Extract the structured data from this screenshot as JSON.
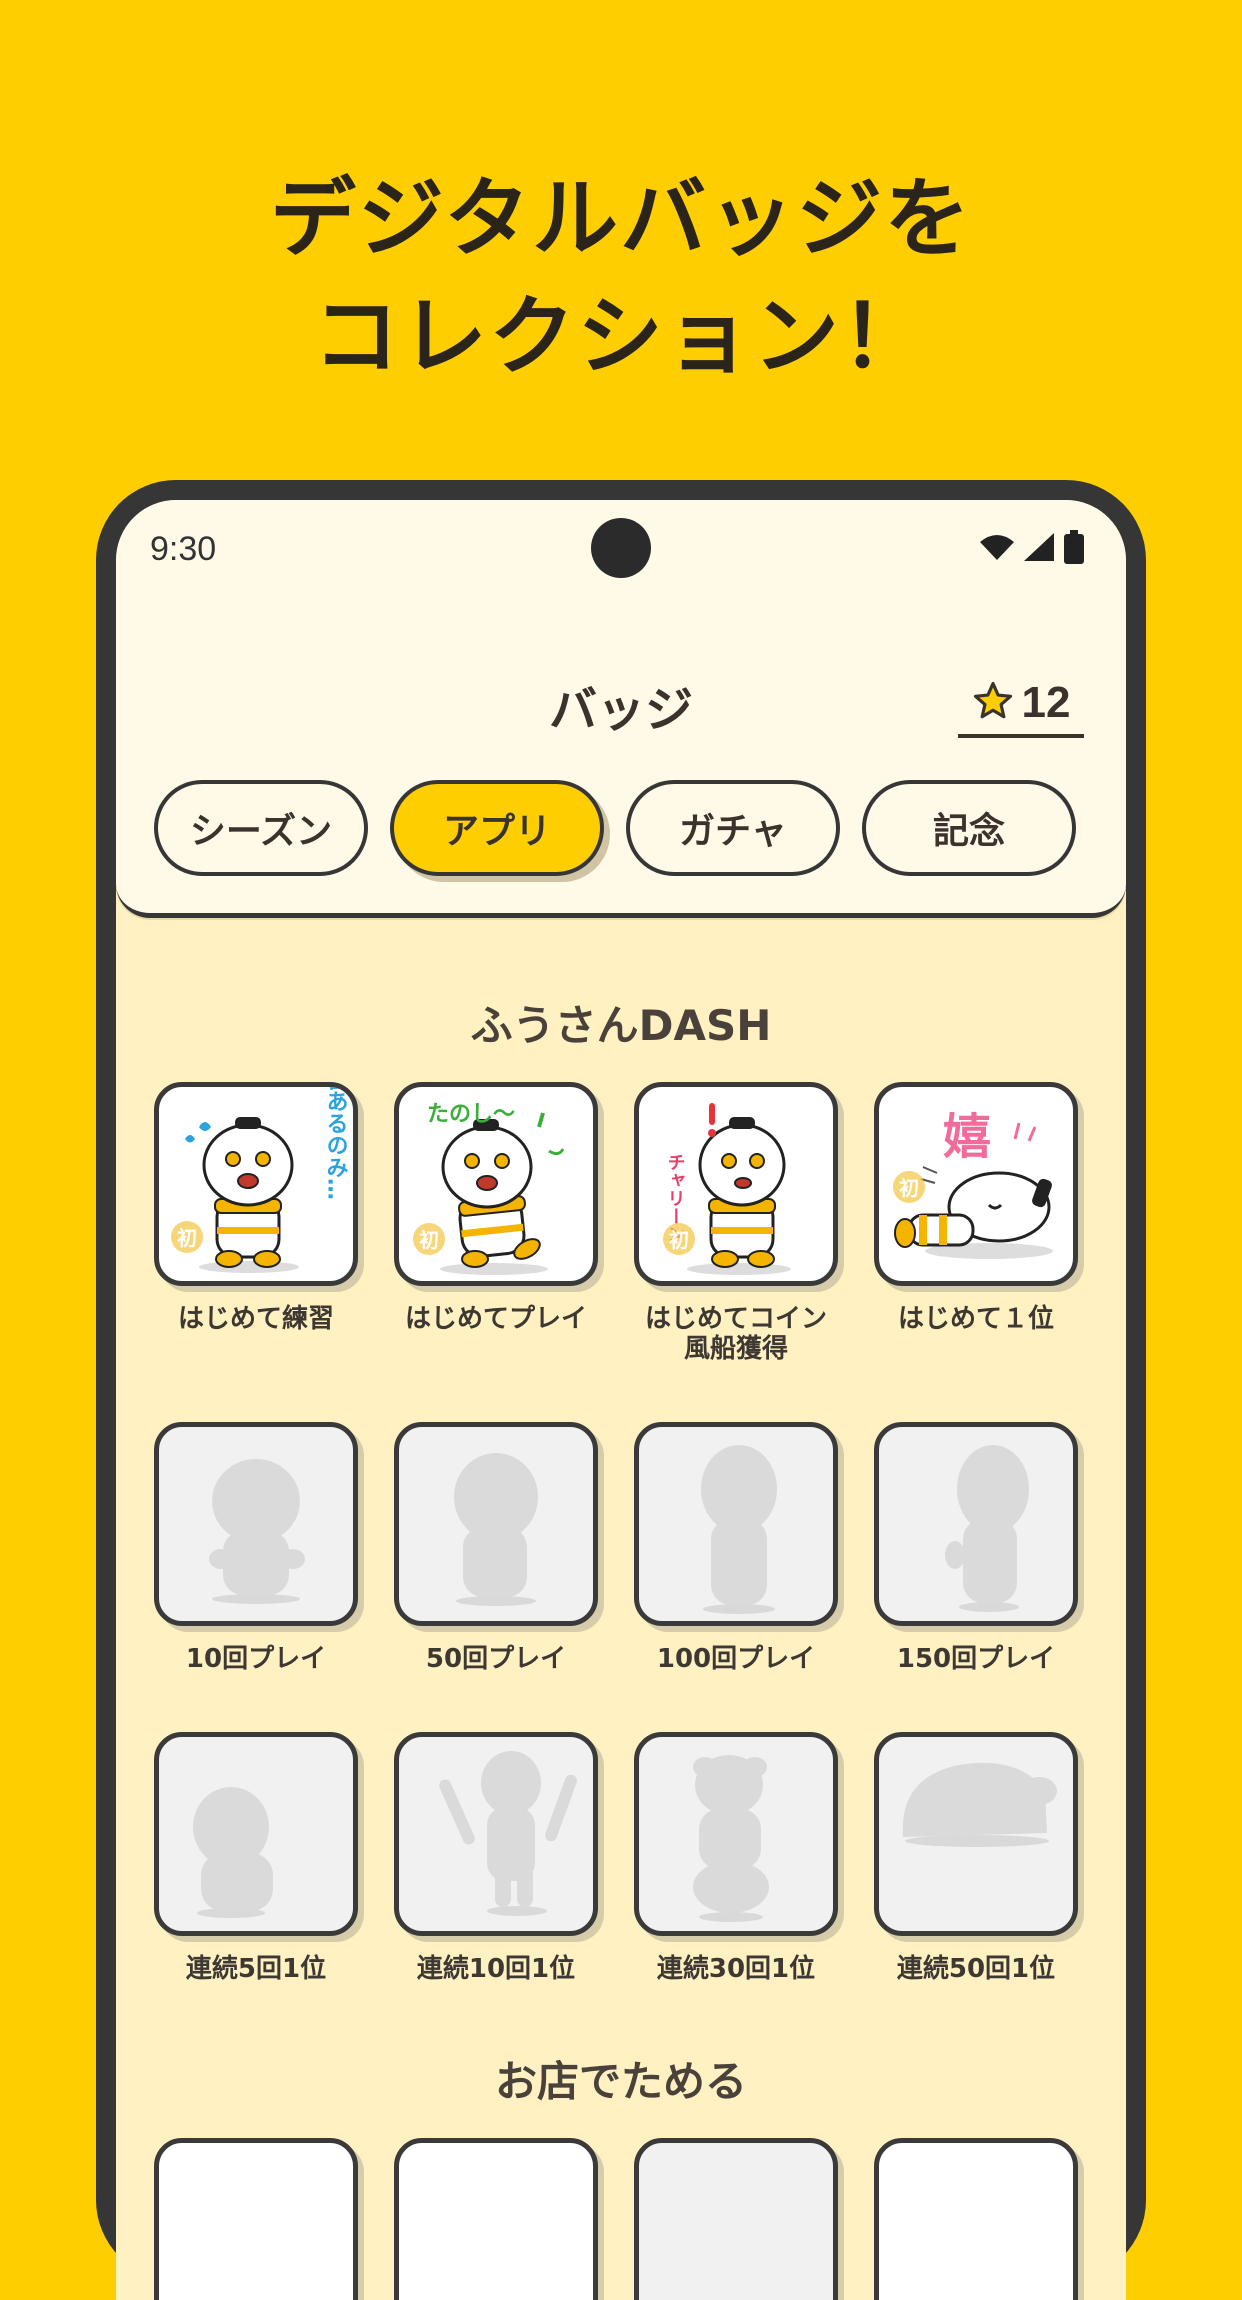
{
  "promo": {
    "line1": "デジタルバッジを",
    "line2": "コレクション！"
  },
  "status_bar": {
    "time": "9:30"
  },
  "header": {
    "title": "バッジ",
    "star_count": "12"
  },
  "tabs": [
    {
      "label": "シーズン",
      "active": false
    },
    {
      "label": "アプリ",
      "active": true
    },
    {
      "label": "ガチャ",
      "active": false
    },
    {
      "label": "記念",
      "active": false
    }
  ],
  "sections": [
    {
      "title": "ふうさんDASH",
      "badges": [
        {
          "label": "はじめて練習",
          "earned": true
        },
        {
          "label": "はじめてプレイ",
          "earned": true
        },
        {
          "label": "はじめてコイン\n風船獲得",
          "earned": true
        },
        {
          "label": "はじめて１位",
          "earned": true
        },
        {
          "label": "10回プレイ",
          "earned": false
        },
        {
          "label": "50回プレイ",
          "earned": false
        },
        {
          "label": "100回プレイ",
          "earned": false
        },
        {
          "label": "150回プレイ",
          "earned": false
        },
        {
          "label": "連続5回1位",
          "earned": false
        },
        {
          "label": "連続10回1位",
          "earned": false
        },
        {
          "label": "連続30回1位",
          "earned": false
        },
        {
          "label": "連続50回1位",
          "earned": false
        }
      ]
    },
    {
      "title": "お店でためる"
    }
  ],
  "badge_art_text": {
    "b1": "練習あるのみ…",
    "b2": "たのし〜",
    "b3": "チャリーン",
    "b4": "嬉",
    "mark": "初"
  },
  "colors": {
    "brand_yellow": "#FFCE00",
    "frame": "#363636",
    "content_bg": "#FFF1C2"
  }
}
